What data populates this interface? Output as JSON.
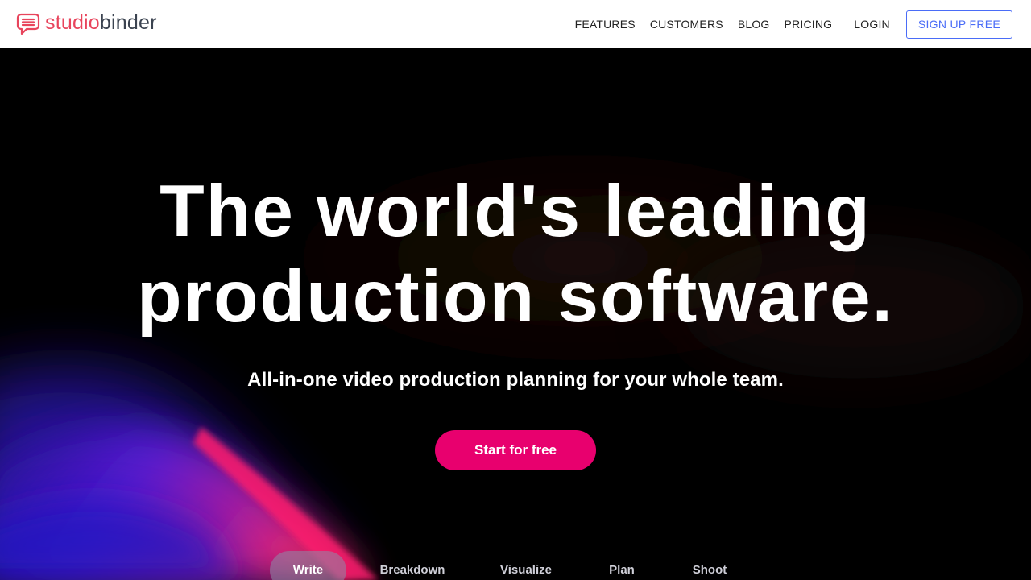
{
  "brand": {
    "name_part1": "studio",
    "name_part2": "binder",
    "icon": "speech-bubble-logo-icon",
    "color_primary": "#e8445c",
    "color_secondary": "#3b4350"
  },
  "nav": {
    "links": [
      {
        "label": "FEATURES"
      },
      {
        "label": "CUSTOMERS"
      },
      {
        "label": "BLOG"
      },
      {
        "label": "PRICING"
      }
    ],
    "login_label": "LOGIN",
    "signup_label": "SIGN UP FREE",
    "signup_color": "#4a6cf7"
  },
  "hero": {
    "title_line1": "The world's leading",
    "title_line2": "production software.",
    "subtitle": "All-in-one video production planning for your whole team.",
    "cta_label": "Start for free",
    "cta_color": "#e8006e"
  },
  "tabs": {
    "items": [
      {
        "label": "Write",
        "active": true
      },
      {
        "label": "Breakdown",
        "active": false
      },
      {
        "label": "Visualize",
        "active": false
      },
      {
        "label": "Plan",
        "active": false
      },
      {
        "label": "Shoot",
        "active": false
      }
    ]
  }
}
